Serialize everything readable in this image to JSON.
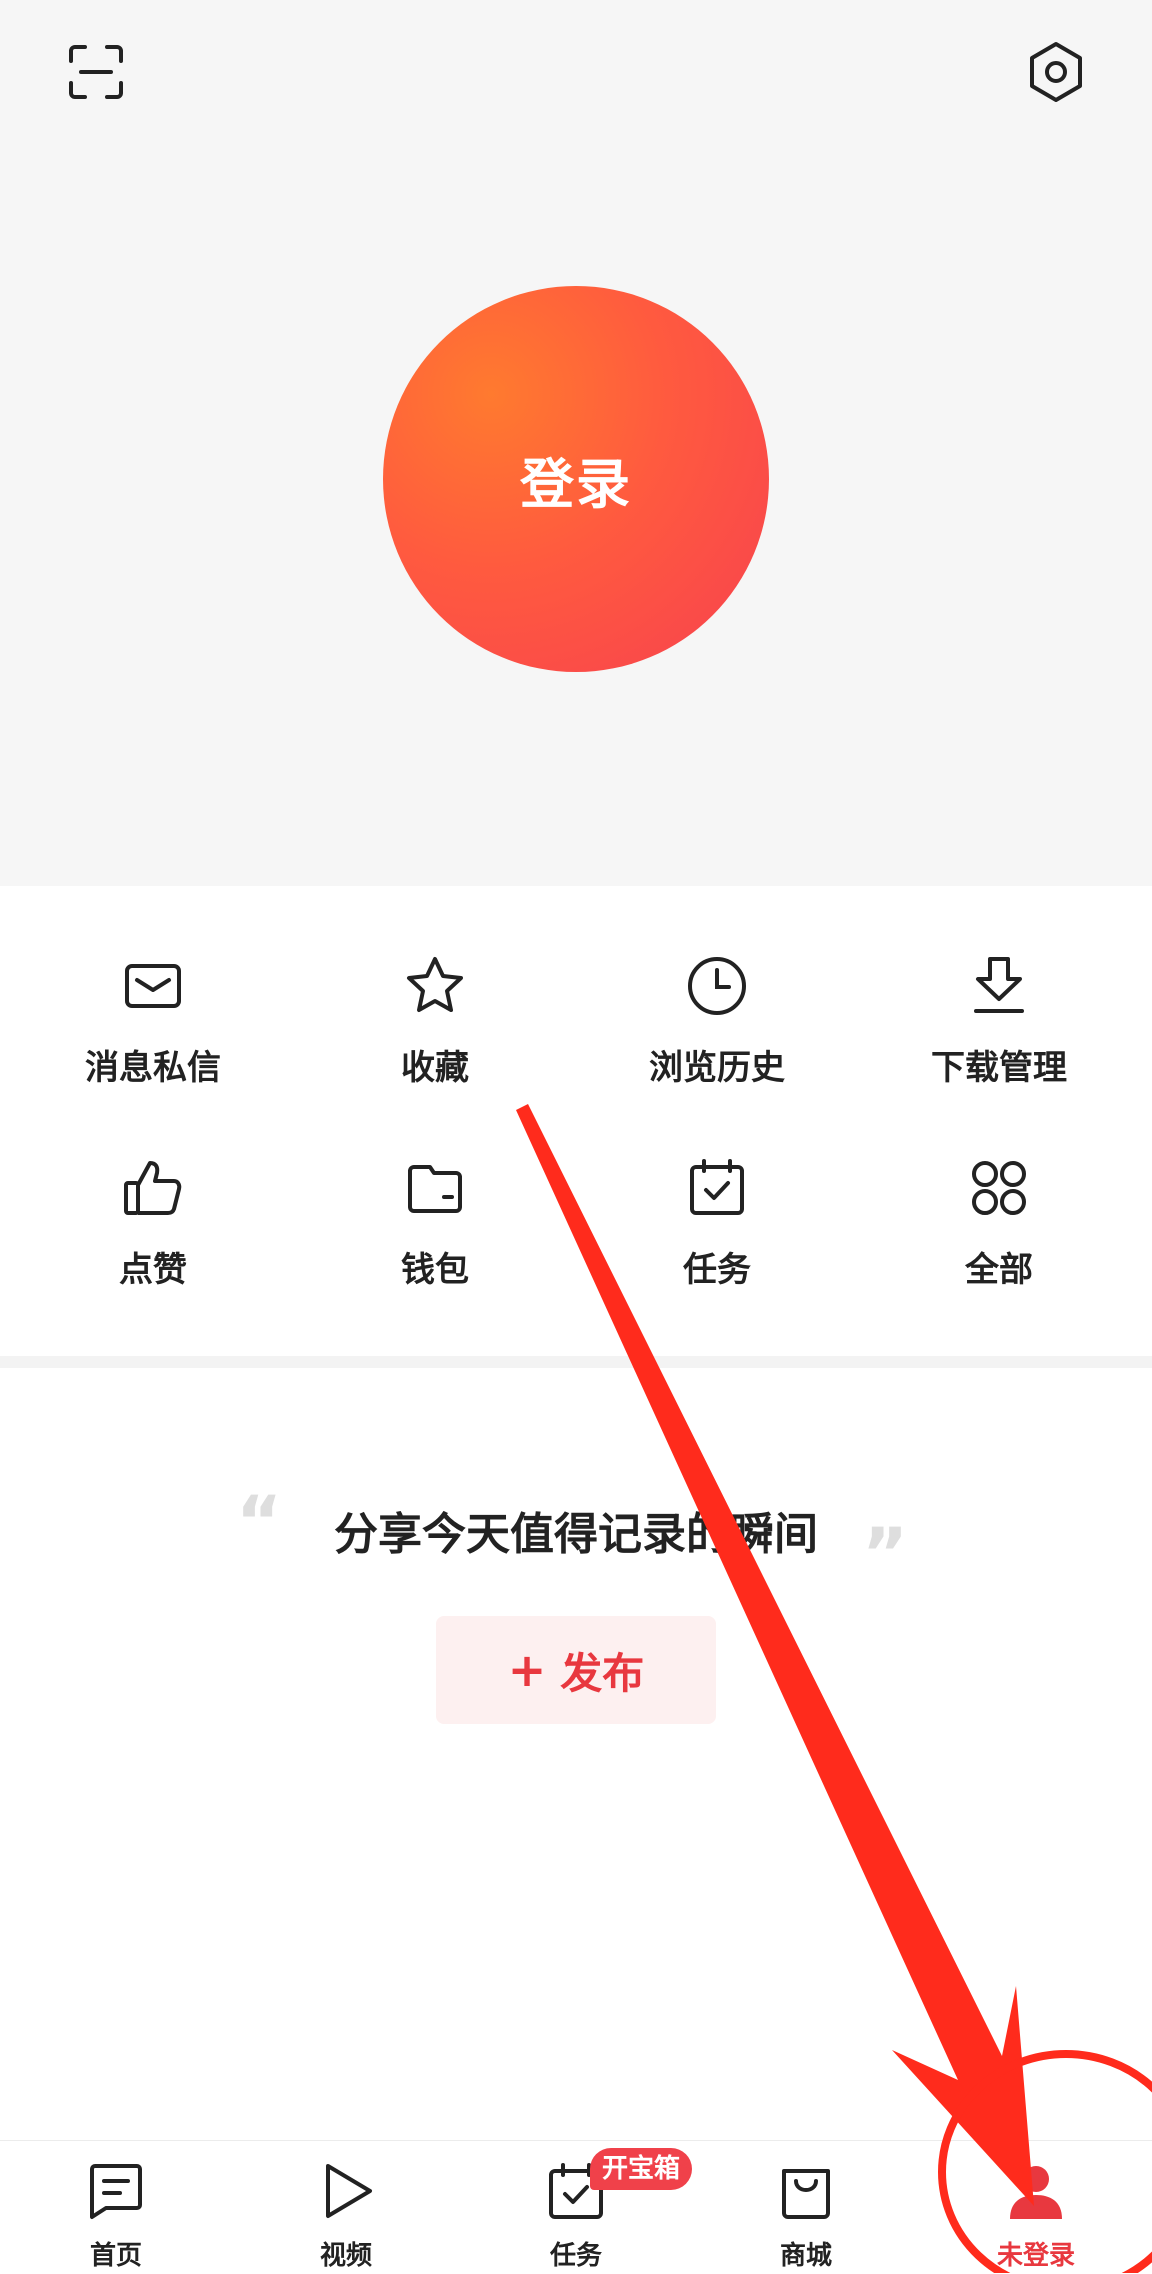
{
  "header": {
    "login_label": "登录"
  },
  "grid": {
    "items": [
      {
        "label": "消息私信",
        "icon": "mail-icon"
      },
      {
        "label": "收藏",
        "icon": "star-icon"
      },
      {
        "label": "浏览历史",
        "icon": "clock-icon"
      },
      {
        "label": "下载管理",
        "icon": "download-icon"
      },
      {
        "label": "点赞",
        "icon": "thumbs-up-icon"
      },
      {
        "label": "钱包",
        "icon": "wallet-icon"
      },
      {
        "label": "任务",
        "icon": "calendar-check-icon"
      },
      {
        "label": "全部",
        "icon": "grid-icon"
      }
    ]
  },
  "share": {
    "text": "分享今天值得记录的瞬间",
    "quote_open": "“",
    "quote_close": "”",
    "publish_plus": "+",
    "publish_label": "发布"
  },
  "nav": {
    "items": [
      {
        "label": "首页",
        "icon": "home-feed-icon"
      },
      {
        "label": "视频",
        "icon": "play-icon"
      },
      {
        "label": "任务",
        "icon": "task-calendar-icon"
      },
      {
        "label": "商城",
        "icon": "shopping-bag-icon"
      },
      {
        "label": "未登录",
        "icon": "user-icon"
      }
    ],
    "badge": "开宝箱",
    "active_index": 4
  },
  "colors": {
    "accent": "#e8383f",
    "login_gradient_start": "#ff7a2f",
    "login_gradient_end": "#f7414f",
    "annotation": "#ff2b1c"
  }
}
